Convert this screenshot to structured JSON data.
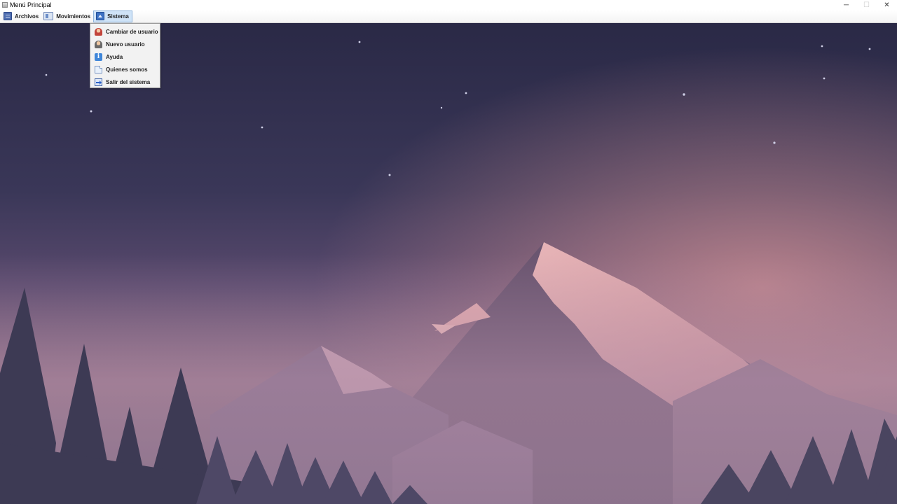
{
  "window": {
    "title": "Menú Principal",
    "controls": {
      "minimize": "─",
      "maximize": "☐",
      "close": "✕"
    }
  },
  "menubar": {
    "items": [
      {
        "label": "Archivos",
        "icon": "list-icon"
      },
      {
        "label": "Movimientos",
        "icon": "movements-icon"
      },
      {
        "label": "Sistema",
        "icon": "system-icon",
        "active": true
      }
    ]
  },
  "dropdown": {
    "parent": "Sistema",
    "items": [
      {
        "label": "Cambiar de usuario",
        "icon": "switch-user-icon"
      },
      {
        "label": "Nuevo usuario",
        "icon": "add-user-icon"
      },
      {
        "label": "Ayuda",
        "icon": "info-icon"
      },
      {
        "label": "Quienes somos",
        "icon": "document-icon"
      },
      {
        "label": "Salir del sistema",
        "icon": "exit-icon"
      }
    ]
  },
  "wallpaper": {
    "subject": "night mountain landscape with crescent moon",
    "colors": {
      "sky_top": "#2a2946",
      "sky_mid": "#5a4a6e",
      "horizon": "#c98c94",
      "mist": "#a7899f",
      "trees": "#3d3a54",
      "moon": "#ffffff"
    }
  },
  "colors": {
    "menu_active_bg": "#cfe3f7",
    "menu_active_border": "#8fb4dc",
    "dropdown_bg": "#f2f2f2"
  }
}
